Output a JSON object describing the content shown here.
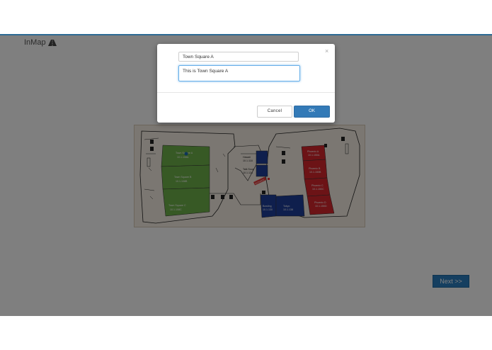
{
  "app": {
    "logo_text": "InMap"
  },
  "modal": {
    "name_value": "Town Square A",
    "description_value": "This is Town Square A",
    "cancel_label": "Cancel",
    "ok_label": "OK",
    "close_glyph": "×"
  },
  "floorplan": {
    "rooms_green": [
      {
        "name": "Town Square A",
        "code": "10.1.108A"
      },
      {
        "name": "Town Square B",
        "code": "10.1.108B"
      },
      {
        "name": "Town Square C",
        "code": "10.1.108C"
      }
    ],
    "rooms_blue": [
      {
        "name": "Hawaii",
        "code": "10.1.118"
      },
      {
        "name": "Talk Soup",
        "code": "10.1.124"
      },
      {
        "name": "Bowling",
        "code": "10.1.130"
      },
      {
        "name": "Tokyo",
        "code": "10.1.138"
      }
    ],
    "rooms_red": [
      {
        "name": "Phoenix A",
        "code": "10.1.150A"
      },
      {
        "name": "Phoenix B",
        "code": "10.1.150B"
      },
      {
        "name": "Phoenix C",
        "code": "10.1.150C"
      },
      {
        "name": "Phoenix D",
        "code": "10.1.150D"
      }
    ],
    "entrance_label": "ENTRANCE"
  },
  "navigation": {
    "next_label": "Next >>"
  },
  "colors": {
    "brand_line": "#2d6a94",
    "button_primary": "#337ab7",
    "next_button": "#2b7fc1",
    "room_green": "#6fb24a",
    "room_blue": "#1f3f9a",
    "room_red": "#d9262c"
  }
}
